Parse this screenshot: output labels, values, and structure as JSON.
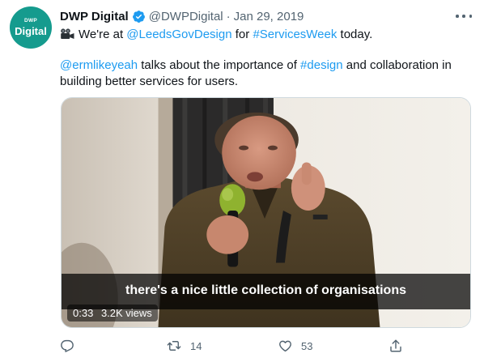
{
  "author": {
    "avatar_small": "DWP",
    "avatar_big": "Digital",
    "name": "DWP Digital",
    "handle": "@DWPDigital",
    "separator": "·",
    "date": "Jan 29, 2019",
    "verified_icon": "verified-badge-icon"
  },
  "tweet": {
    "line1_prefix": "We're at ",
    "line1_mention": "@LeedsGovDesign",
    "line1_mid": " for ",
    "line1_hashtag": "#ServicesWeek",
    "line1_suffix": " today.",
    "line2_mention": "@ermlikeyeah",
    "line2_mid": " talks about the importance of ",
    "line2_hashtag": "#design",
    "line2_suffix": " and collaboration in",
    "line3": "building better services for users."
  },
  "video": {
    "subtitle": "there's a nice little collection of organisations",
    "duration": "0:33",
    "views": "3.2K views"
  },
  "actions": {
    "reply_icon": "reply-icon",
    "retweet_icon": "retweet-icon",
    "retweet_count": "14",
    "like_icon": "heart-icon",
    "like_count": "53",
    "share_icon": "share-icon"
  },
  "colors": {
    "link": "#1d9bf0",
    "text": "#0f1419",
    "secondary": "#536471",
    "avatar_bg": "#159b8e"
  }
}
